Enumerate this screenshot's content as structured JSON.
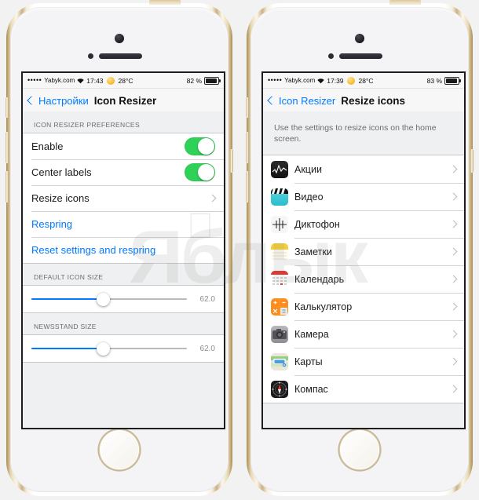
{
  "watermark": {
    "text": "Яблык",
    "apple_glyph": ""
  },
  "phones": [
    {
      "id": "left",
      "status_bar": {
        "signal_dots": "•••••",
        "carrier": "Yabyk.com",
        "wifi_icon": "wifi-icon",
        "time": "17:43",
        "weather_icon": "sun-icon",
        "temperature": "28°C",
        "battery_percent": "82 %",
        "battery_icon": "battery-icon"
      },
      "nav": {
        "back_icon": "chevron-left-icon",
        "back_label": "Настройки",
        "title": "Icon Resizer"
      },
      "sections": [
        {
          "header": "ICON RESIZER PREFERENCES",
          "rows": [
            {
              "label": "Enable",
              "control": "toggle",
              "state": "on"
            },
            {
              "label": "Center labels",
              "control": "toggle",
              "state": "on"
            },
            {
              "label": "Resize icons",
              "control": "chevron"
            },
            {
              "label": "Respring",
              "control": "none",
              "style": "link"
            },
            {
              "label": "Reset settings and respring",
              "control": "none",
              "style": "link"
            }
          ]
        },
        {
          "header": "DEFAULT ICON SIZE",
          "slider": {
            "value": "62.0",
            "fill_percent": 46
          }
        },
        {
          "header": "NEWSSTAND SIZE",
          "slider": {
            "value": "62.0",
            "fill_percent": 46
          }
        }
      ]
    },
    {
      "id": "right",
      "status_bar": {
        "signal_dots": "•••••",
        "carrier": "Yabyk.com",
        "wifi_icon": "wifi-icon",
        "time": "17:39",
        "weather_icon": "sun-icon",
        "temperature": "28°C",
        "battery_percent": "83 %",
        "battery_icon": "battery-icon"
      },
      "nav": {
        "back_icon": "chevron-left-icon",
        "back_label": "Icon Resizer",
        "title": "Resize icons"
      },
      "intro_text": "Use the settings to resize icons on the home screen.",
      "apps": [
        {
          "name": "Акции",
          "icon": "stocks-icon"
        },
        {
          "name": "Видео",
          "icon": "videos-icon"
        },
        {
          "name": "Диктофон",
          "icon": "voice-memos-icon"
        },
        {
          "name": "Заметки",
          "icon": "notes-icon"
        },
        {
          "name": "Календарь",
          "icon": "calendar-icon"
        },
        {
          "name": "Калькулятор",
          "icon": "calculator-icon"
        },
        {
          "name": "Камера",
          "icon": "camera-icon"
        },
        {
          "name": "Карты",
          "icon": "maps-icon"
        },
        {
          "name": "Компас",
          "icon": "compass-icon"
        }
      ]
    }
  ],
  "colors": {
    "accent_blue": "#007aff",
    "toggle_green": "#2fd157",
    "group_header_gray": "#6d6d72",
    "separator": "#d4d4d8"
  }
}
